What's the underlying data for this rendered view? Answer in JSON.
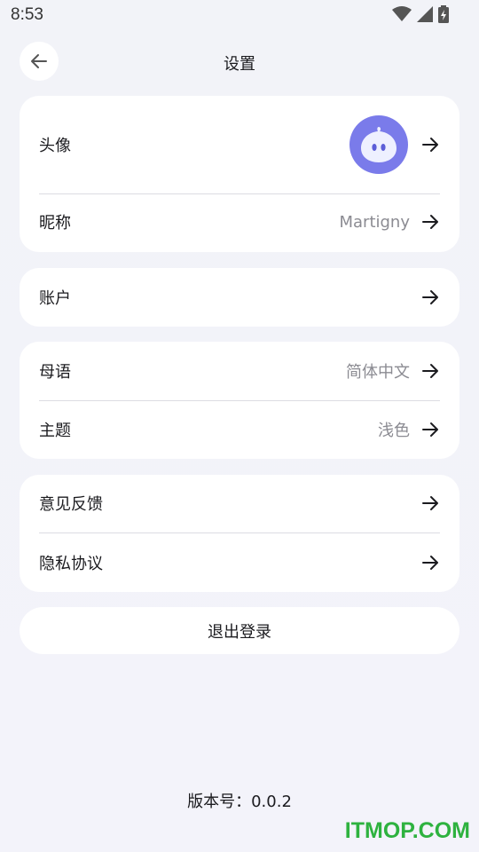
{
  "status_bar": {
    "time": "8:53"
  },
  "header": {
    "title": "设置"
  },
  "profile_card": {
    "avatar_label": "头像",
    "nickname_label": "昵称",
    "nickname_value": "Martigny"
  },
  "account_card": {
    "label": "账户"
  },
  "prefs_card": {
    "language_label": "母语",
    "language_value": "简体中文",
    "theme_label": "主题",
    "theme_value": "浅色"
  },
  "misc_card": {
    "feedback_label": "意见反馈",
    "privacy_label": "隐私协议"
  },
  "logout_label": "退出登录",
  "version_text": "版本号：0.0.2",
  "watermark": "ITMOP.COM",
  "colors": {
    "accent": "#7a7bea",
    "background": "#f2f3f8",
    "card": "#ffffff",
    "watermark": "#2eb23f"
  }
}
